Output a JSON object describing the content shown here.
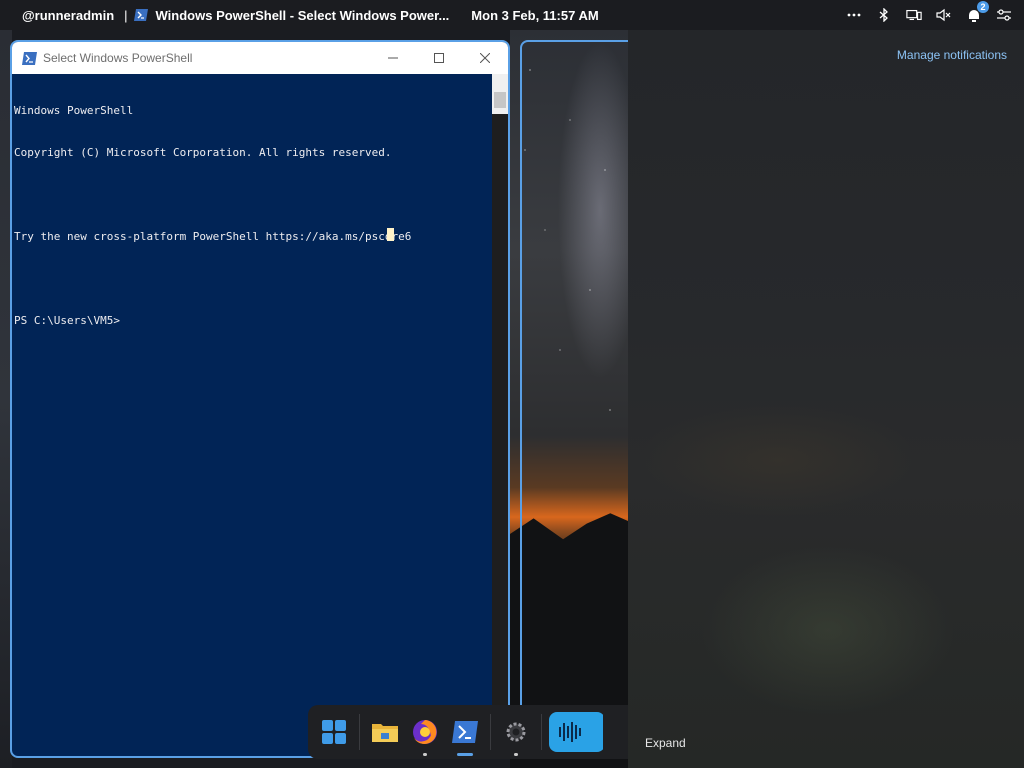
{
  "topbar": {
    "user": "@runneradmin",
    "separator": "|",
    "active_app": "Windows PowerShell - Select Windows Power...",
    "clock": "Mon 3 Feb, 11:57 AM",
    "tray_icons": [
      "more-icon",
      "bluetooth-icon",
      "display-icon",
      "volume-muted-icon",
      "notifications-icon",
      "settings-toggle-icon"
    ],
    "notification_count": "2"
  },
  "window": {
    "title": "Select Windows PowerShell",
    "controls": [
      "minimize-icon",
      "maximize-icon",
      "close-icon"
    ]
  },
  "console": {
    "lines": [
      "Windows PowerShell",
      "Copyright (C) Microsoft Corporation. All rights reserved.",
      "",
      "Try the new cross-platform PowerShell https://aka.ms/pscore6",
      "",
      "PS C:\\Users\\VM5>"
    ],
    "background": "#012456",
    "foreground": "#eeedf0"
  },
  "notifications": {
    "manage_label": "Manage notifications",
    "expand_label": "Expand",
    "link_color": "#8cc3f5"
  },
  "dock": {
    "items": [
      "start-icon",
      "file-explorer-icon",
      "firefox-icon",
      "powershell-icon",
      "settings-icon",
      "audio-app-icon"
    ]
  },
  "accent": "#5aa0e6"
}
